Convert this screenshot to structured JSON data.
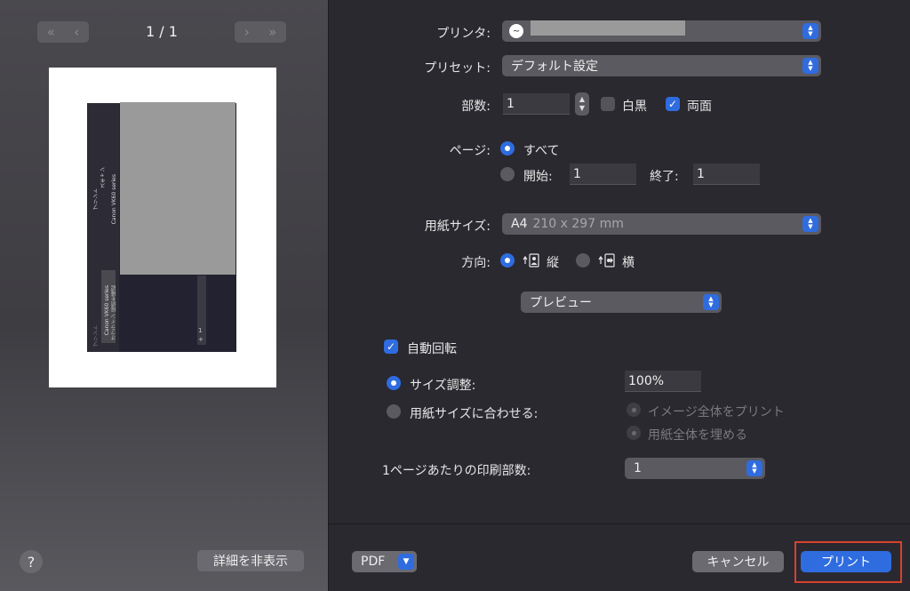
{
  "preview": {
    "page_indicator": "1 / 1",
    "hide_details_label": "詳細を非表示",
    "help_label": "?",
    "thumb_text_1": "プリント",
    "thumb_text_2": "スキャン",
    "thumb_text_3": "Canon VK60 series",
    "thumb_text_4": "Canon VK60 series",
    "thumb_text_5": "オフライン 接続を確認",
    "thumb_text_6": "プリント",
    "thumb_page": "1",
    "thumb_plus": "+"
  },
  "form": {
    "printer_label": "プリンタ:",
    "printer_value": "",
    "preset_label": "プリセット:",
    "preset_value": "デフォルト設定",
    "copies_label": "部数:",
    "copies_value": "1",
    "bw_label": "白黒",
    "duplex_label": "両面",
    "pages_label": "ページ:",
    "pages_all": "すべて",
    "pages_from_label": "開始:",
    "pages_from_value": "1",
    "pages_to_label": "終了:",
    "pages_to_value": "1",
    "paper_size_label": "用紙サイズ:",
    "paper_size_name": "A4",
    "paper_size_dims": "210 x 297 mm",
    "orientation_label": "方向:",
    "orientation_portrait": "縦",
    "orientation_landscape": "横",
    "section_popup": "プレビュー",
    "auto_rotate_label": "自動回転",
    "scale_label": "サイズ調整:",
    "scale_value": "100%",
    "fit_label": "用紙サイズに合わせる:",
    "fit_option_1": "イメージ全体をプリント",
    "fit_option_2": "用紙全体を埋める",
    "copies_per_page_label": "1ページあたりの印刷部数:",
    "copies_per_page_value": "1"
  },
  "footer": {
    "pdf_label": "PDF",
    "cancel_label": "キャンセル",
    "print_label": "プリント"
  },
  "colors": {
    "accent": "#2f6ce0",
    "highlight": "#d9412c"
  }
}
